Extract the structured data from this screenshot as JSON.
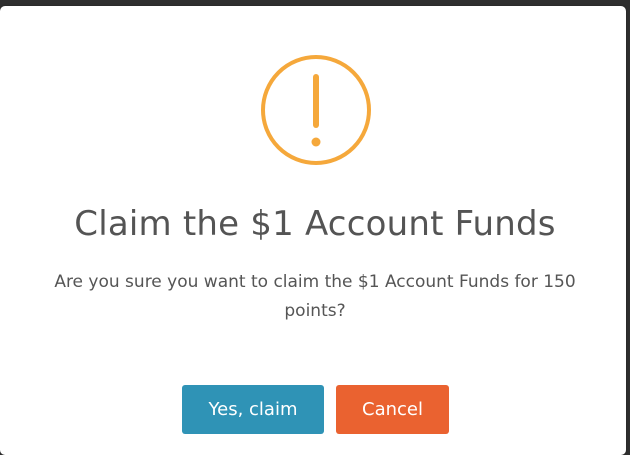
{
  "dialog": {
    "title": "Claim the $1 Account Funds",
    "message": "Are you sure you want to claim the $1 Account Funds for 150 points?",
    "icon": "warning-icon",
    "icon_color": "#f5a83b",
    "confirm_label": "Yes, claim",
    "confirm_color": "#2f93b6",
    "cancel_label": "Cancel",
    "cancel_color": "#ea6230"
  }
}
